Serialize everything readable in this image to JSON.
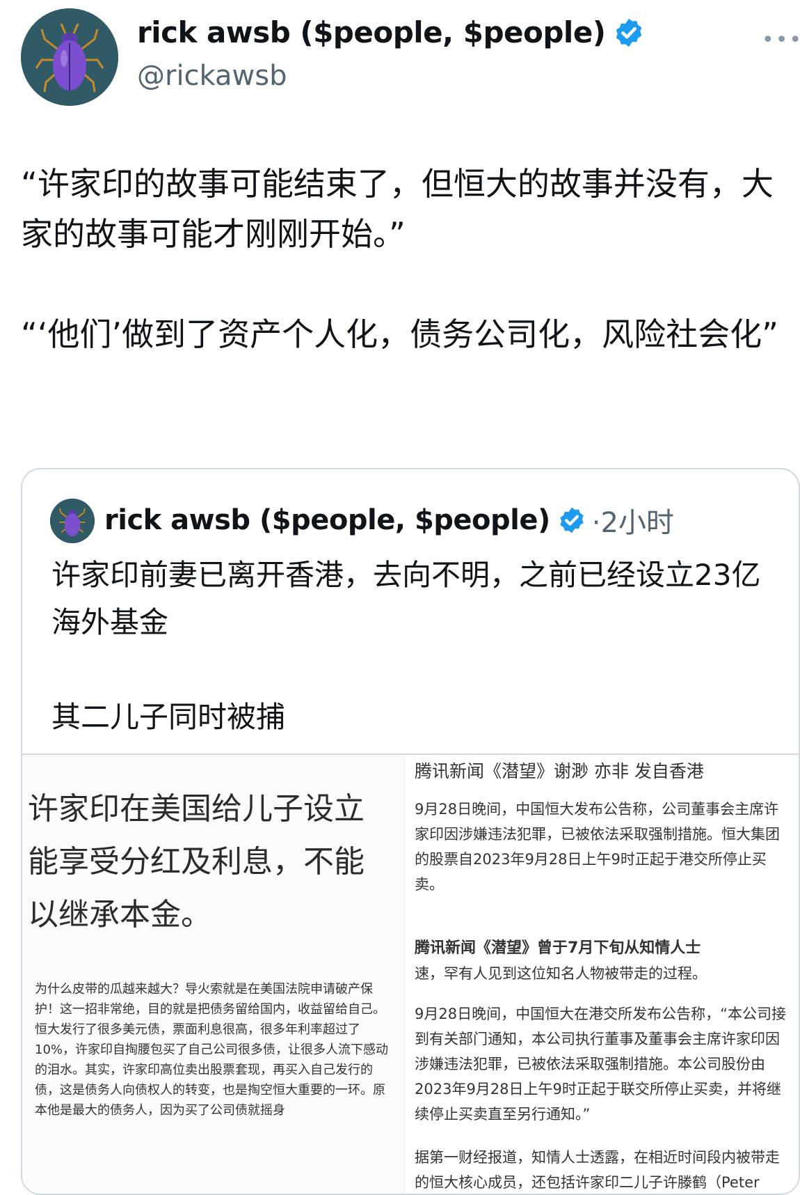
{
  "author": {
    "display_name": "rick awsb ($people, $people)",
    "handle": "@rickawsb"
  },
  "tweet": {
    "paragraph_1": "“许家印的故事可能结束了，但恒大的故事并没有，大家的故事可能才刚刚开始。”",
    "paragraph_2": "“‘他们’做到了资产个人化，债务公司化，风险社会化”"
  },
  "quoted_tweet": {
    "display_name": "rick awsb ($people, $people)",
    "time": "·2小时",
    "text_1": "许家印前妻已离开香港，去向不明，之前已经设立23亿海外基金",
    "text_2": "其二儿子同时被捕"
  },
  "media_left": {
    "big_line_1": "许家印在美国给儿子设立",
    "big_line_2": "能享受分红及利息，不能",
    "big_line_3": "以继承本金。",
    "small_text": "为什么皮带的瓜越来越大？导火索就是在美国法院申请破产保护！这一招非常绝，目的就是把债务留给国内，收益留给自己。恒大发行了很多美元债，票面利息很高，很多年利率超过了10%，许家印自掏腰包买了自己公司很多债，让很多人流下感动的泪水。其实，许家印高位卖出股票套现，再买入自己发行的债，这是债务人向债权人的转变，也是掏空恒大重要的一环。原本他是最大的债务人，因为买了公司债就摇身"
  },
  "media_right": {
    "header": "腾讯新闻《潜望》谢渺 亦非 发自香港",
    "para_1": "9月28日晚间，中国恒大发布公告称，公司董事会主席许家印因涉嫌违法犯罪，已被依法采取强制措施。恒大集团的股票自2023年9月28日上午9时正起于港交所停止买卖。",
    "bold_line": "腾讯新闻《潜望》曾于7月下旬从知情人士",
    "para_2": "速，罕有人见到这位知名人物被带走的过程。",
    "para_3": "9月28日晚间，中国恒大在港交所发布公告称，“本公司接到有关部门通知，本公司执行董事及董事会主席许家印因涉嫌违法犯罪，已被依法采取强制措施。本公司股份由2023年9月28日上午9时正起于联交所停止买卖，并将继续停止买卖直至另行通知。”",
    "para_4": "据第一财经报道，知情人士透露，在相近时间段内被带走的恒大核心成员，还包括许家印二儿子许滕鹤（Peter"
  },
  "icons": {
    "verified": "verified-badge-icon",
    "more": "more-options-icon",
    "avatar": "purple-beetle-avatar"
  },
  "colors": {
    "verified_blue": "#1d9bf0",
    "secondary_text": "#536471",
    "border": "#cfd9de"
  }
}
